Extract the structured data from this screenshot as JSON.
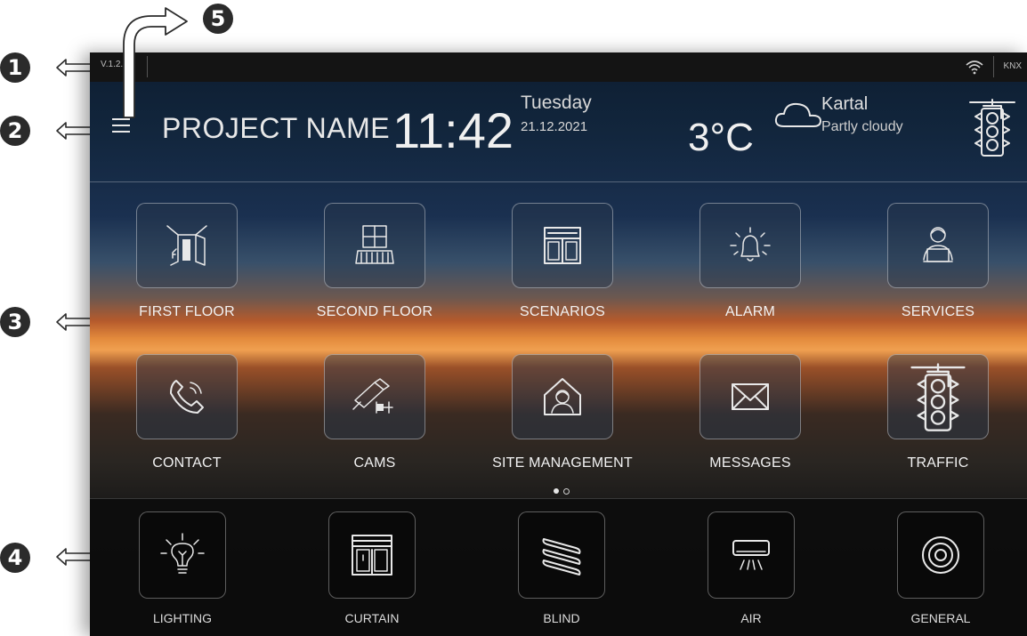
{
  "markers": [
    "1",
    "2",
    "3",
    "4",
    "5"
  ],
  "statusbar": {
    "version": "V.1.2.3",
    "bus": "KNX",
    "wifi_icon": "wifi-icon"
  },
  "header": {
    "menu_icon": "hamburger-menu-icon",
    "project_name": "PROJECT NAME",
    "time": "11:42",
    "day": "Tuesday",
    "date": "21.12.2021",
    "temperature": "3°C",
    "weather_icon": "cloud-icon",
    "location": "Kartal",
    "condition": "Partly cloudy",
    "traffic_icon": "traffic-light-icon"
  },
  "grid": {
    "tiles": [
      {
        "label": "FIRST FLOOR",
        "icon": "door-room-icon"
      },
      {
        "label": "SECOND FLOOR",
        "icon": "window-balcony-icon"
      },
      {
        "label": "SCENARIOS",
        "icon": "layout-icon"
      },
      {
        "label": "ALARM",
        "icon": "bell-icon"
      },
      {
        "label": "SERVICES",
        "icon": "person-laptop-icon"
      },
      {
        "label": "CONTACT",
        "icon": "phone-icon"
      },
      {
        "label": "CAMS",
        "icon": "security-camera-icon"
      },
      {
        "label": "SITE MANAGEMENT",
        "icon": "house-person-icon"
      },
      {
        "label": "MESSAGES",
        "icon": "envelope-icon"
      },
      {
        "label": "TRAFFIC",
        "icon": "traffic-light-icon"
      }
    ],
    "page_indicator": {
      "pages": 2,
      "current": 1
    }
  },
  "bottom_bar": {
    "items": [
      {
        "label": "LIGHTING",
        "icon": "lightbulb-icon"
      },
      {
        "label": "CURTAIN",
        "icon": "curtain-icon"
      },
      {
        "label": "BLIND",
        "icon": "blind-icon"
      },
      {
        "label": "AIR",
        "icon": "air-conditioner-icon"
      },
      {
        "label": "GENERAL",
        "icon": "general-target-icon"
      }
    ]
  },
  "colors": {
    "page_background": "#ffffff",
    "status_bar": "#141414",
    "bottom_bar": "#0c0c0c",
    "text": "#f2f2f2",
    "marker": "#2b2b2b"
  }
}
